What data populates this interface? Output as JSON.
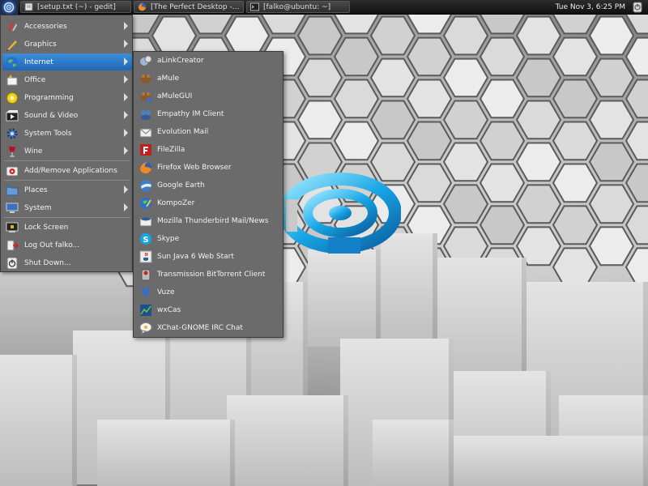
{
  "top_panel": {
    "tasks": [
      {
        "label": "[setup.txt (~) - gedit]"
      },
      {
        "label": "[The Perfect Desktop -..."
      },
      {
        "label": "[falko@ubuntu: ~]"
      }
    ],
    "clock": "Tue Nov  3,  6:25 PM"
  },
  "main_menu": {
    "items": [
      {
        "label": "Accessories",
        "icon": "accessories-icon"
      },
      {
        "label": "Graphics",
        "icon": "graphics-icon"
      },
      {
        "label": "Internet",
        "icon": "internet-icon"
      },
      {
        "label": "Office",
        "icon": "office-icon"
      },
      {
        "label": "Programming",
        "icon": "programming-icon"
      },
      {
        "label": "Sound & Video",
        "icon": "sound-video-icon"
      },
      {
        "label": "System Tools",
        "icon": "system-tools-icon"
      },
      {
        "label": "Wine",
        "icon": "wine-icon"
      },
      {
        "label": "Add/Remove Applications",
        "icon": "add-remove-icon"
      },
      {
        "label": "Places",
        "icon": "places-icon"
      },
      {
        "label": "System",
        "icon": "system-icon"
      },
      {
        "label": "Lock Screen",
        "icon": "lock-icon"
      },
      {
        "label": "Log Out falko...",
        "icon": "logout-icon"
      },
      {
        "label": "Shut Down...",
        "icon": "shutdown-icon"
      }
    ]
  },
  "internet_menu": {
    "items": [
      {
        "label": "aLinkCreator"
      },
      {
        "label": "aMule"
      },
      {
        "label": "aMuleGUI"
      },
      {
        "label": "Empathy IM Client"
      },
      {
        "label": "Evolution Mail"
      },
      {
        "label": "FileZilla"
      },
      {
        "label": "Firefox Web Browser"
      },
      {
        "label": "Google Earth"
      },
      {
        "label": "KompoZer"
      },
      {
        "label": "Mozilla Thunderbird Mail/News"
      },
      {
        "label": "Skype"
      },
      {
        "label": "Sun Java 6 Web Start"
      },
      {
        "label": "Transmission BitTorrent Client"
      },
      {
        "label": "Vuze"
      },
      {
        "label": "wxCas"
      },
      {
        "label": "XChat-GNOME IRC Chat"
      }
    ]
  },
  "colors": {
    "menu_bg": "#6b6b6b",
    "highlight": "#2f7fd0",
    "panel_bg": "#1a1a1a"
  }
}
